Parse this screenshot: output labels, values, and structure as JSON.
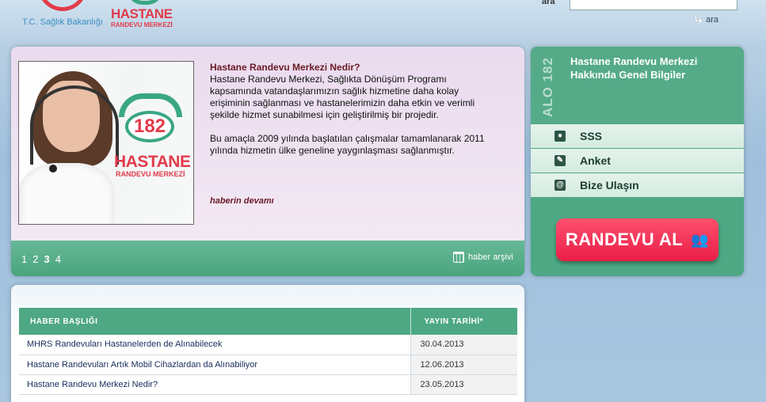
{
  "header": {
    "logo_left_text": "T.C. Sağlık Bakanlığı",
    "logo_right_title": "HASTANE",
    "logo_right_subtitle": "RANDEVU MERKEZİ",
    "search_label": "ara",
    "search_value": "",
    "search_button": "ara"
  },
  "slider": {
    "badge_number": "182",
    "badge_title": "HASTANE",
    "badge_subtitle": "RANDEVU MERKEZİ",
    "heading": "Hastane Randevu Merkezi Nedir?",
    "paragraph1": "Hastane Randevu Merkezi, Sağlıkta Dönüşüm Programı kapsamında vatandaşlarımızın sağlık hizmetine daha kolay erişiminin sağlanması ve hastanelerimizin daha etkin ve verimli şekilde hizmet sunabilmesi için geliştirilmiş bir projedir.",
    "paragraph2": "Bu amaçla 2009 yılında başlatılan çalışmalar tamamlanarak 2011 yılında hizmetin ülke geneline yaygınlaşması sağlanmıştır.",
    "more_link": "haberin devamı",
    "pages": [
      "1",
      "2",
      "3",
      "4"
    ],
    "active_page": "3",
    "archive_label": "haber arşivi"
  },
  "info": {
    "vertical_label": "ALO 182",
    "title": "Hastane Randevu Merkezi Hakkında Genel Bilgiler",
    "menu": [
      {
        "label": "SSS",
        "icon": "person-icon"
      },
      {
        "label": "Anket",
        "icon": "edit-icon"
      },
      {
        "label": "Bize Ulaşın",
        "icon": "at-icon"
      }
    ],
    "cta_label": "RANDEVU AL",
    "accent": "#4ea884",
    "cta_color": "#e91e48"
  },
  "news_table": {
    "col_title": "HABER BAŞLIĞI",
    "col_date": "YAYIN TARİHİ*",
    "rows": [
      {
        "title": "MHRS Randevuları Hastanelerden de Alınabilecek",
        "date": "30.04.2013"
      },
      {
        "title": "Hastane Randevuları Artık Mobil Cihazlardan da Alınabiliyor",
        "date": "12.06.2013"
      },
      {
        "title": "Hastane Randevu Merkezi Nedir?",
        "date": "23.05.2013"
      }
    ]
  }
}
